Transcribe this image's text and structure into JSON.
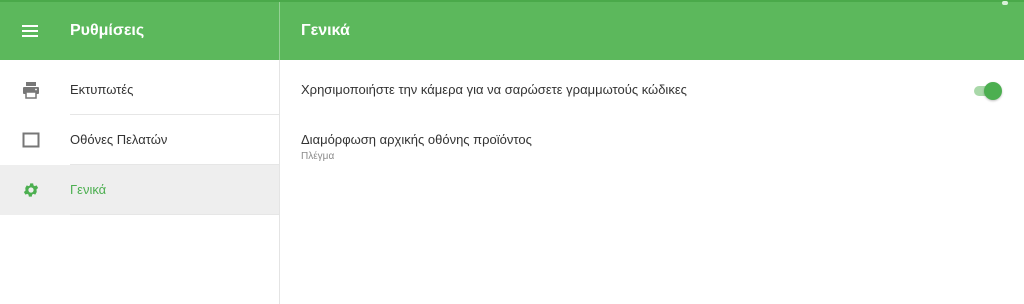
{
  "topbar": {
    "menu_icon": "hamburger-menu-icon",
    "left_title": "Ρυθμίσεις",
    "right_title": "Γενικά",
    "color": "#5cb85c"
  },
  "sidebar": {
    "items": [
      {
        "label": "Εκτυπωτές",
        "icon": "printer-icon",
        "active": false
      },
      {
        "label": "Οθόνες Πελατών",
        "icon": "display-icon",
        "active": false
      },
      {
        "label": "Γενικά",
        "icon": "gear-icon",
        "active": true
      }
    ],
    "active_color": "#4caf50"
  },
  "content": {
    "settings": [
      {
        "title": "Χρησιμοποιήστε την κάμερα για να σαρώσετε γραμμωτούς κώδικες",
        "toggle_on": true
      },
      {
        "title": "Διαμόρφωση αρχικής οθόνης προϊόντος",
        "subtitle": "Πλέγμα"
      }
    ]
  }
}
